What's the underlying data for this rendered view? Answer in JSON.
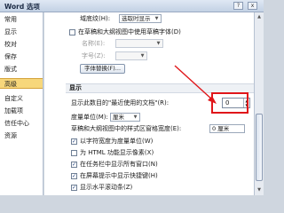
{
  "window": {
    "title": "Word 选项",
    "help": "?",
    "close": "x"
  },
  "sidebar": {
    "items": [
      {
        "label": "常用"
      },
      {
        "label": "显示"
      },
      {
        "label": "校对"
      },
      {
        "label": "保存"
      },
      {
        "label": "版式"
      },
      {
        "label": "高级",
        "active": true
      },
      {
        "label": "自定义"
      },
      {
        "label": "加载项"
      },
      {
        "label": "信任中心"
      },
      {
        "label": "资源"
      }
    ]
  },
  "content": {
    "field_top_label": "域底纹(H):",
    "field_top_value": "选取时显示",
    "draft_font_label": "在草稿和大纲视图中使用草稿字体(D)",
    "name_label": "名称(E):",
    "size_label": "字号(Z):",
    "font_sub_btn": "字体替换(F)...",
    "section_display": "显示",
    "recent_docs_label": "显示此数目的\"最近使用的文档\"(R):",
    "recent_docs_value": "0",
    "units_label": "度量单位(M):",
    "units_value": "厘米",
    "style_area_label": "草稿和大纲视图中的样式区窗格宽度(E):",
    "style_area_value": "0 厘米",
    "cb1": "以字符宽度为度量单位(W)",
    "cb2": "为 HTML 功能显示像素(X)",
    "cb3": "在任务栏中显示所有窗口(N)",
    "cb4": "在屏幕提示中显示快捷键(H)",
    "cb5": "显示水平滚动条(Z)"
  }
}
